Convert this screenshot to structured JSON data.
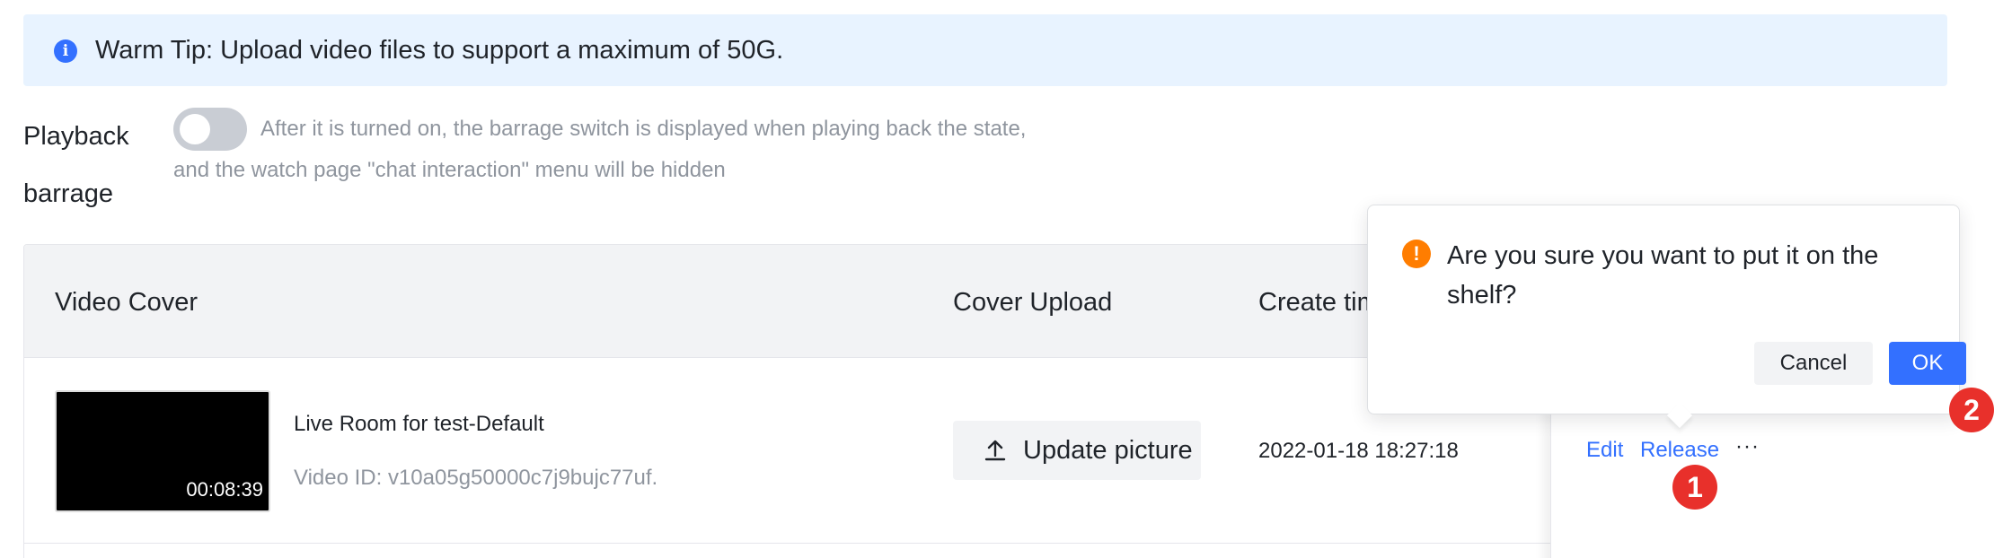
{
  "tip": {
    "icon": "info-icon",
    "icon_glyph": "i",
    "text": "Warm Tip: Upload video files to support a maximum of 50G."
  },
  "playback": {
    "label_line1": "Playback",
    "label_line2": "barrage",
    "toggle_on": false,
    "desc_line1": "After it is turned on, the barrage switch is displayed when playing back the state,",
    "desc_line2": "and the watch page \"chat interaction\" menu will be hidden"
  },
  "table": {
    "headers": [
      "Video Cover",
      "Cover Upload",
      "Create time"
    ],
    "rows": [
      {
        "duration": "00:08:39",
        "title": "Live Room for test-Default",
        "video_id": "Video ID:  v10a05g50000c7j9bujc77uf.",
        "upload_label": "Update picture",
        "upload_icon": "upload-icon",
        "create_time": "2022-01-18 18:27:18",
        "actions": {
          "edit": "Edit",
          "release": "Release",
          "more": "···"
        }
      }
    ]
  },
  "popover": {
    "icon": "warning-icon",
    "icon_glyph": "!",
    "message": "Are you sure you want to put it on the shelf?",
    "cancel_label": "Cancel",
    "ok_label": "OK"
  },
  "markers": [
    "1",
    "2"
  ],
  "colors": {
    "accent": "#3370ff",
    "warning": "#ff7d00",
    "marker": "#e8302b",
    "tip_bg": "#e8f3ff"
  }
}
